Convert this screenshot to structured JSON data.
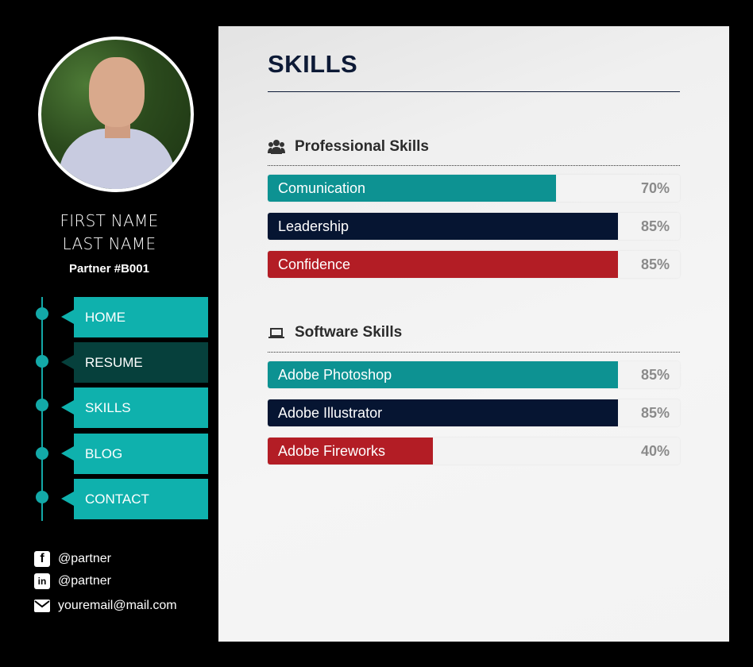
{
  "profile": {
    "first_name": "FIRST NAME",
    "last_name": "LAST NAME",
    "partner_id": "Partner #B001"
  },
  "nav": {
    "items": [
      {
        "label": "HOME",
        "active": false
      },
      {
        "label": "RESUME",
        "active": true
      },
      {
        "label": "SKILLS",
        "active": false
      },
      {
        "label": "BLOG",
        "active": false
      },
      {
        "label": "CONTACT",
        "active": false
      }
    ]
  },
  "social": {
    "facebook": "@partner",
    "linkedin": "@partner",
    "email": "youremail@mail.com"
  },
  "main": {
    "title": "SKILLS",
    "professional": {
      "heading": "Professional Skills",
      "icon": "users-icon",
      "skills": [
        {
          "label": "Comunication",
          "percent_text": "70%",
          "value": 70,
          "color": "#0d9292"
        },
        {
          "label": "Leadership",
          "percent_text": "85%",
          "value": 85,
          "color": "#061532"
        },
        {
          "label": "Confidence",
          "percent_text": "85%",
          "value": 85,
          "color": "#b31d25"
        }
      ]
    },
    "software": {
      "heading": "Software Skills",
      "icon": "laptop-icon",
      "skills": [
        {
          "label": "Adobe Photoshop",
          "percent_text": "85%",
          "value": 85,
          "color": "#0d9292"
        },
        {
          "label": "Adobe Illustrator",
          "percent_text": "85%",
          "value": 85,
          "color": "#061532"
        },
        {
          "label": "Adobe Fireworks",
          "percent_text": "40%",
          "value": 40,
          "color": "#b31d25"
        }
      ]
    }
  },
  "colors": {
    "accent_teal": "#0fb1ad",
    "active_nav": "#06403c",
    "navy": "#0d1a36"
  }
}
